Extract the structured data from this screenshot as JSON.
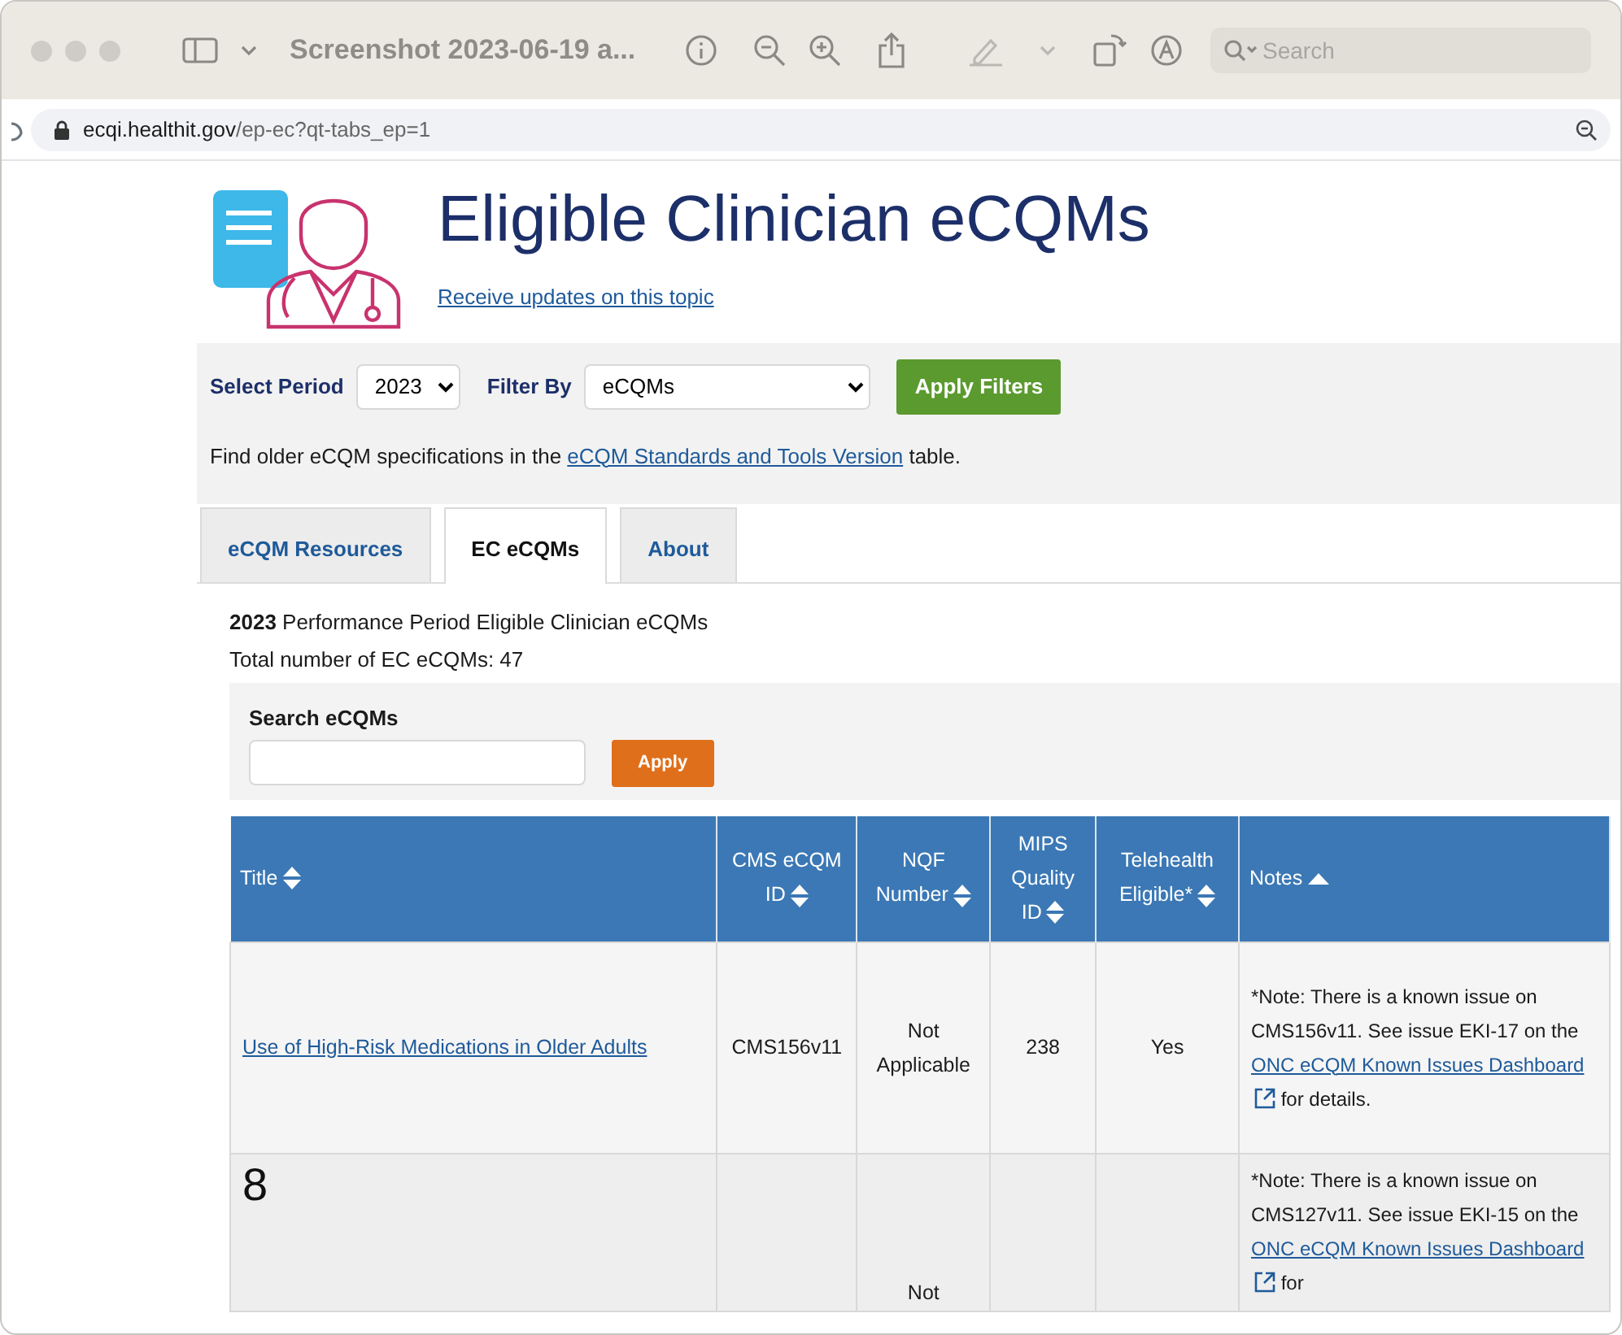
{
  "window": {
    "title": "Screenshot 2023-06-19 a...",
    "search_placeholder": "Search"
  },
  "browser": {
    "url_host": "ecqi.healthit.gov",
    "url_path": "/ep-ec?qt-tabs_ep=1"
  },
  "header": {
    "title": "Eligible Clinician eCQMs",
    "subscribe_link": "Receive updates on this topic"
  },
  "filters": {
    "period_label": "Select Period",
    "period_value": "2023",
    "filter_label": "Filter By",
    "filter_value": "eCQMs",
    "apply_button": "Apply Filters",
    "note": {
      "before": "Find older eCQM specifications in the ",
      "link": "eCQM Standards and Tools Version",
      "after": " table."
    }
  },
  "tabs": [
    {
      "label": "eCQM Resources",
      "selected": false
    },
    {
      "label": "EC eCQMs",
      "selected": true
    },
    {
      "label": "About",
      "selected": false
    }
  ],
  "summary": {
    "heading": "**2023** Performance Period Eligible Clinician eCQMs",
    "total": "Total number of EC eCQMs: 47"
  },
  "search": {
    "label": "Search eCQMs",
    "button": "Apply"
  },
  "table": {
    "columns": [
      {
        "label": "Title",
        "sorted": false
      },
      {
        "label": "CMS eCQM ID",
        "sorted": false
      },
      {
        "label": "NQF Number",
        "sorted": false
      },
      {
        "label": "MIPS Quality ID",
        "sorted": false
      },
      {
        "label": "Telehealth Eligible*",
        "sorted": false
      },
      {
        "label": "Notes",
        "sorted": true
      }
    ],
    "rows": [
      {
        "title": "Use of High-Risk Medications in Older Adults",
        "cms_id": "CMS156v11",
        "nqf": "Not Applicable",
        "mips": "238",
        "telehealth": "Yes",
        "notes": {
          "before": "*Note: There is a known issue on CMS156v11. See issue EKI-17 on the ",
          "link": "ONC eCQM Known Issues Dashboard",
          "after": " for details."
        }
      },
      {
        "overlay_number": "8",
        "nqf": "Not",
        "notes": {
          "before": "*Note: There is a known issue on CMS127v11. See issue EKI-15 on the ",
          "link": "ONC eCQM Known Issues Dashboard",
          "after": " for"
        }
      }
    ]
  }
}
